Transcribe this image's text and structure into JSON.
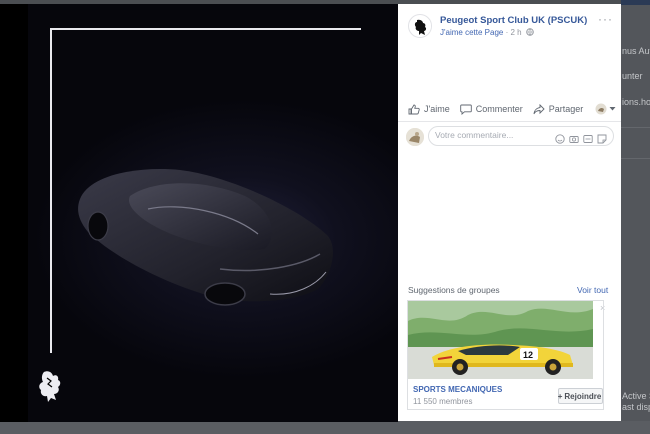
{
  "post": {
    "page_name": "Peugeot Sport Club UK (PSCUK)",
    "like_page": "J'aime cette Page",
    "separator": " · ",
    "time": "2 h",
    "globe_icon": "globe-icon",
    "more": "···"
  },
  "actions": {
    "like": "J'aime",
    "comment": "Commenter",
    "share": "Partager"
  },
  "comment_box": {
    "placeholder": "Votre commentaire..."
  },
  "suggestions": {
    "title": "Suggestions de groupes",
    "see_all": "Voir tout",
    "close": "×",
    "group_name": "SPORTS MECANIQUES",
    "members": "11 550 membres",
    "join_plus": "+",
    "join": "Rejoindre"
  },
  "background": {
    "line1": "nus Aut",
    "line2": "unter",
    "line3": "ions.hot",
    "line4": "Active S",
    "line5": "ast dispo"
  },
  "colors": {
    "link": "#365899",
    "accent": "#4267b2",
    "muted": "#90949c"
  }
}
